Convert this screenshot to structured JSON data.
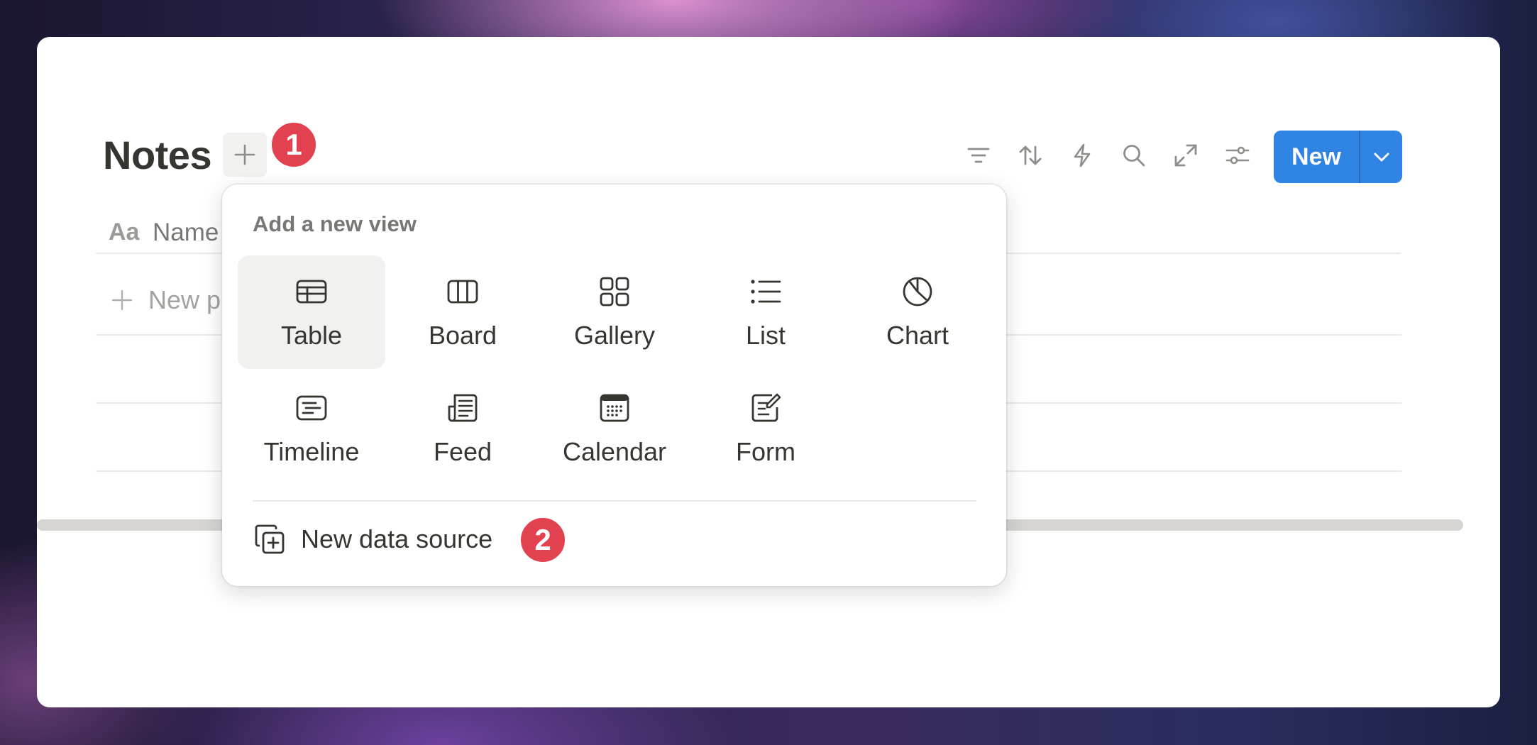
{
  "database": {
    "title": "Notes",
    "add_view_icon": "plus-icon",
    "column_name_label": "Name",
    "column_type_icon_text": "Aa",
    "new_page_label": "New p"
  },
  "toolbar": {
    "icons": [
      "filter-icon",
      "sort-icon",
      "automation-icon",
      "search-icon",
      "expand-icon",
      "settings-icon"
    ],
    "new_button_label": "New",
    "accent_color": "#2f83e2"
  },
  "view_menu": {
    "heading": "Add a new view",
    "options": [
      {
        "label": "Table",
        "icon": "table-icon",
        "selected": true
      },
      {
        "label": "Board",
        "icon": "board-icon"
      },
      {
        "label": "Gallery",
        "icon": "gallery-icon"
      },
      {
        "label": "List",
        "icon": "list-icon"
      },
      {
        "label": "Chart",
        "icon": "chart-icon"
      },
      {
        "label": "Timeline",
        "icon": "timeline-icon"
      },
      {
        "label": "Feed",
        "icon": "feed-icon"
      },
      {
        "label": "Calendar",
        "icon": "calendar-icon"
      },
      {
        "label": "Form",
        "icon": "form-icon"
      }
    ],
    "new_data_source_label": "New data source"
  },
  "annotations": {
    "step1": "1",
    "step2": "2",
    "badge_color": "#e2424f"
  }
}
